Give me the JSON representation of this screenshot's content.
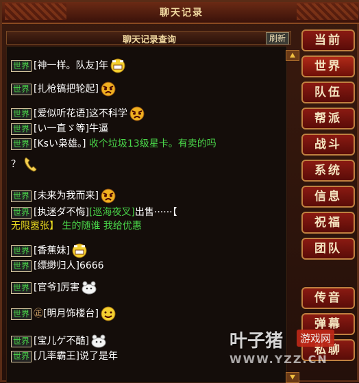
{
  "window": {
    "title": "聊天记录"
  },
  "header": {
    "subtitle": "聊天记录查询",
    "refresh_label": "刷新"
  },
  "channel_label": "世界",
  "messages": [
    {
      "sender": "[神一样。队友]",
      "text": "年",
      "emote": "grin"
    },
    {
      "sender": "[扎枪镐把轮起]",
      "text": "",
      "emote": "angry"
    },
    {
      "sender": "[爱似听花语]",
      "text": "这不科学",
      "emote": "angry"
    },
    {
      "sender": "[い一直ゞ等]",
      "text": "牛逼",
      "emote": ""
    },
    {
      "sender": "[Ksい枭雄。]",
      "text": "收个垃圾13级星卡。有卖的吗",
      "cont": "？",
      "emote": "phone"
    },
    {
      "sender": "[未来为我而来]",
      "text": "",
      "emote": "angry"
    },
    {
      "sender": "[执迷ダ不悔]",
      "item": "[巡海夜叉]",
      "text": "出售······【",
      "cont1": "无限嚣张】",
      "cont2": "生的随谁 我给优惠"
    },
    {
      "sender": "[香蕉妹]",
      "text": "",
      "emote": "grin"
    },
    {
      "sender": "[缥缈归人]",
      "text": "6666",
      "emote": ""
    },
    {
      "sender": "[官爷]",
      "text": "厉害",
      "emote": "sheep"
    },
    {
      "sender": "[明月饰楼台]",
      "text": "",
      "emote": "smile",
      "prefix": "㊣"
    },
    {
      "sender": "[宝儿ゲ不酷]",
      "text": "",
      "emote": "sheep"
    },
    {
      "sender": "[几率霸王]",
      "text": "说了是年",
      "emote": ""
    }
  ],
  "tabs": [
    "当前",
    "世界",
    "队伍",
    "帮派",
    "战斗",
    "系统",
    "信息",
    "祝福",
    "团队",
    "传音",
    "弹幕",
    "私聊"
  ],
  "watermark": {
    "brand": "叶子猪",
    "tag": "游戏网",
    "url": "WWW.YZZ.CN"
  }
}
